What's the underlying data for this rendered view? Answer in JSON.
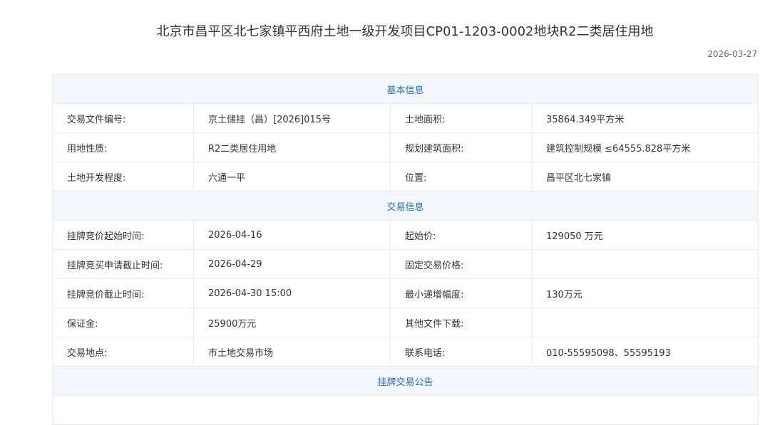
{
  "page": {
    "title": "北京市昌平区北七家镇平西府土地一级开发项目CP01-1203-0002地块R2二类居住用地",
    "date": "2026-03-27"
  },
  "sections": {
    "basic": "基本信息",
    "trade": "交易信息",
    "notice": "挂牌交易公告"
  },
  "basic_rows": [
    {
      "l1": "交易文件编号:",
      "v1": "京土储挂（昌）[2026]015号",
      "l2": "土地面积:",
      "v2": "35864.349平方米"
    },
    {
      "l1": "用地性质:",
      "v1": "R2二类居住用地",
      "l2": "规划建筑面积:",
      "v2": "建筑控制规模 ≤64555.828平方米"
    },
    {
      "l1": "土地开发程度:",
      "v1": "六通一平",
      "l2": "位置:",
      "v2": "昌平区北七家镇"
    }
  ],
  "trade_rows": [
    {
      "l1": "挂牌竞价起始时间:",
      "v1": "2026-04-16",
      "l2": "起始价:",
      "v2": "129050 万元"
    },
    {
      "l1": "挂牌竞买申请截止时间:",
      "v1": "2026-04-29",
      "l2": "固定交易价格:",
      "v2": ""
    },
    {
      "l1": "挂牌竞价截止时间:",
      "v1": "2026-04-30 15:00",
      "l2": "最小递增幅度:",
      "v2": "130万元"
    },
    {
      "l1": "保证金:",
      "v1": "25900万元",
      "l2": "其他文件下载:",
      "v2": ""
    },
    {
      "l1": "交易地点:",
      "v1": "市土地交易市场",
      "l2": "联系电话:",
      "v2": "010-55595098、55595193"
    }
  ]
}
